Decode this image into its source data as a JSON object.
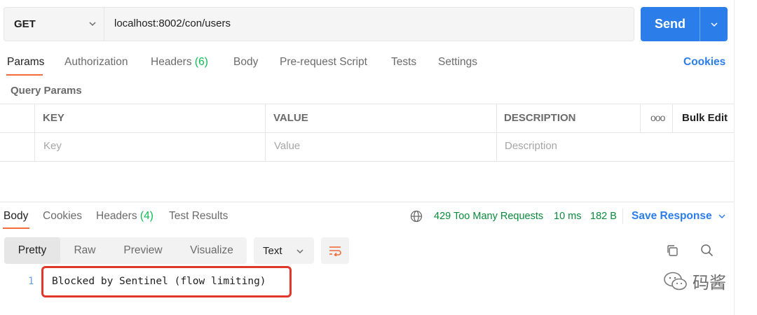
{
  "request": {
    "method": "GET",
    "url": "localhost:8002/con/users",
    "send_label": "Send"
  },
  "tabs": [
    {
      "label": "Params",
      "active": true
    },
    {
      "label": "Authorization"
    },
    {
      "label": "Headers",
      "count": "(6)"
    },
    {
      "label": "Body"
    },
    {
      "label": "Pre-request Script"
    },
    {
      "label": "Tests"
    },
    {
      "label": "Settings"
    }
  ],
  "cookies_link": "Cookies",
  "query_params": {
    "title": "Query Params",
    "columns": [
      "KEY",
      "VALUE",
      "DESCRIPTION"
    ],
    "placeholders": [
      "Key",
      "Value",
      "Description"
    ],
    "more_label": "ooo",
    "bulk_edit": "Bulk Edit"
  },
  "response": {
    "tabs": [
      {
        "label": "Body",
        "active": true
      },
      {
        "label": "Cookies"
      },
      {
        "label": "Headers",
        "count": "(4)"
      },
      {
        "label": "Test Results"
      }
    ],
    "status": "429 Too Many Requests",
    "time": "10 ms",
    "size": "182 B",
    "save_label": "Save Response",
    "view_modes": [
      "Pretty",
      "Raw",
      "Preview",
      "Visualize"
    ],
    "active_view": "Pretty",
    "format": "Text",
    "lines": [
      {
        "number": "1",
        "text": "Blocked by Sentinel (flow limiting)"
      }
    ]
  },
  "watermark": "码酱",
  "colors": {
    "accent": "#2b7de9",
    "active_tab": "#f26b3a",
    "status_error_text": "#0a8a3b",
    "highlight_box": "#e1372a"
  }
}
